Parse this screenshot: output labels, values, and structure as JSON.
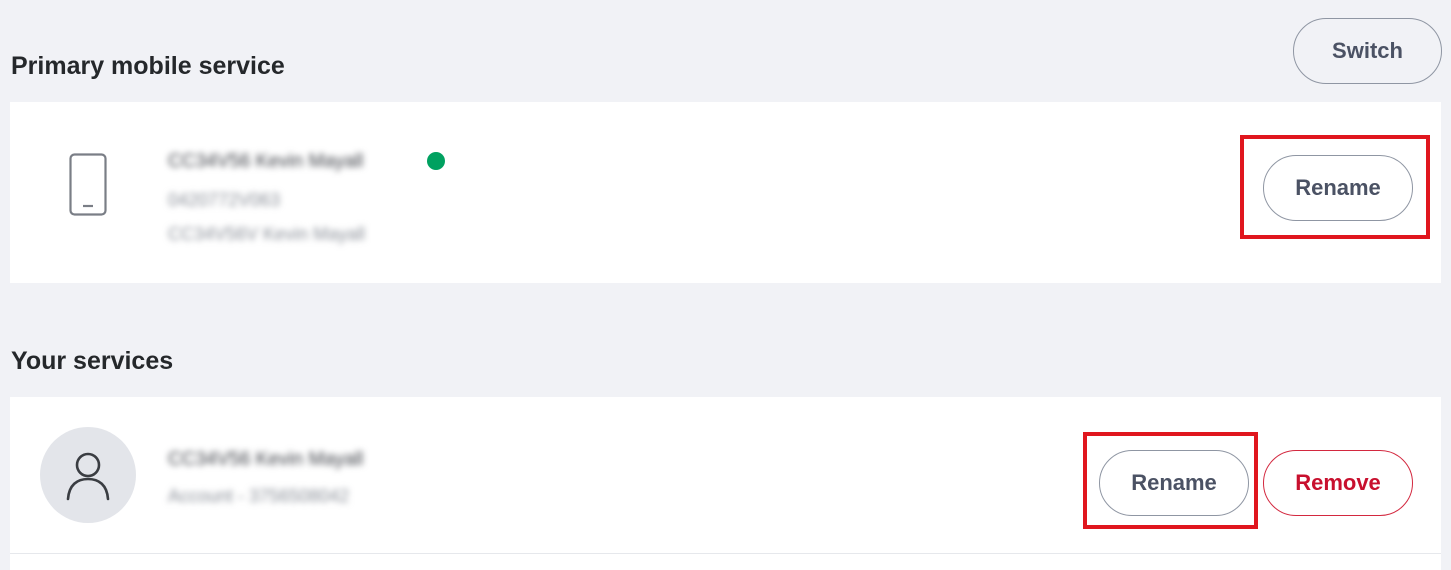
{
  "primary": {
    "title": "Primary mobile service",
    "switch_label": "Switch",
    "service_name": "CC34V56 Kevin Mayall",
    "service_number": "0420772V063",
    "service_account": "CC34V56V Kevin Mayall",
    "status_color": "#00a160",
    "rename_label": "Rename",
    "icon": "mobile-phone-icon"
  },
  "services": {
    "title": "Your services",
    "items": [
      {
        "name": "CC34V56 Kevin Mayall",
        "account": "Account - 3756508042",
        "icon": "user-avatar-icon",
        "rename_label": "Rename",
        "remove_label": "Remove"
      }
    ]
  },
  "colors": {
    "highlight": "#e0161e",
    "remove": "#c8102e",
    "background": "#f1f2f6"
  }
}
